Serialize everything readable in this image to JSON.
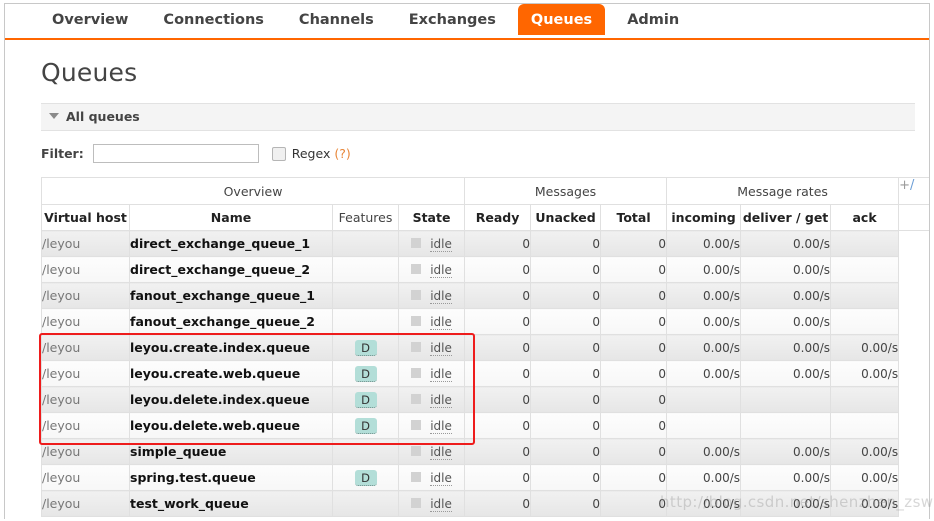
{
  "nav": {
    "tabs": [
      {
        "label": "Overview",
        "active": false
      },
      {
        "label": "Connections",
        "active": false
      },
      {
        "label": "Channels",
        "active": false
      },
      {
        "label": "Exchanges",
        "active": false
      },
      {
        "label": "Queues",
        "active": true
      },
      {
        "label": "Admin",
        "active": false
      }
    ],
    "active_color": "#ff6600"
  },
  "page": {
    "title": "Queues",
    "section_title": "All queues"
  },
  "filter": {
    "label": "Filter:",
    "value": "",
    "placeholder": "",
    "regex_label": "Regex",
    "regex_checked": false,
    "help": "(?)"
  },
  "table": {
    "group_headers": [
      {
        "label": "Overview",
        "span": 4
      },
      {
        "label": "Messages",
        "span": 3
      },
      {
        "label": "Message rates",
        "span": 3
      }
    ],
    "columns": [
      {
        "label": "Virtual host",
        "sortable": true
      },
      {
        "label": "Name",
        "sortable": true
      },
      {
        "label": "Features",
        "sortable": false
      },
      {
        "label": "State",
        "sortable": true
      },
      {
        "label": "Ready",
        "sortable": true
      },
      {
        "label": "Unacked",
        "sortable": true
      },
      {
        "label": "Total",
        "sortable": true
      },
      {
        "label": "incoming",
        "sortable": true
      },
      {
        "label": "deliver / get",
        "sortable": true
      },
      {
        "label": "ack",
        "sortable": true
      }
    ],
    "plus_minus": "+/",
    "rows": [
      {
        "vhost": "/leyou",
        "name": "direct_exchange_queue_1",
        "features": "",
        "state": "idle",
        "ready": "0",
        "unacked": "0",
        "total": "0",
        "incoming": "0.00/s",
        "deliver_get": "0.00/s",
        "ack": ""
      },
      {
        "vhost": "/leyou",
        "name": "direct_exchange_queue_2",
        "features": "",
        "state": "idle",
        "ready": "0",
        "unacked": "0",
        "total": "0",
        "incoming": "0.00/s",
        "deliver_get": "0.00/s",
        "ack": ""
      },
      {
        "vhost": "/leyou",
        "name": "fanout_exchange_queue_1",
        "features": "",
        "state": "idle",
        "ready": "0",
        "unacked": "0",
        "total": "0",
        "incoming": "0.00/s",
        "deliver_get": "0.00/s",
        "ack": ""
      },
      {
        "vhost": "/leyou",
        "name": "fanout_exchange_queue_2",
        "features": "",
        "state": "idle",
        "ready": "0",
        "unacked": "0",
        "total": "0",
        "incoming": "0.00/s",
        "deliver_get": "0.00/s",
        "ack": ""
      },
      {
        "vhost": "/leyou",
        "name": "leyou.create.index.queue",
        "features": "D",
        "state": "idle",
        "ready": "0",
        "unacked": "0",
        "total": "0",
        "incoming": "0.00/s",
        "deliver_get": "0.00/s",
        "ack": "0.00/s"
      },
      {
        "vhost": "/leyou",
        "name": "leyou.create.web.queue",
        "features": "D",
        "state": "idle",
        "ready": "0",
        "unacked": "0",
        "total": "0",
        "incoming": "0.00/s",
        "deliver_get": "0.00/s",
        "ack": "0.00/s"
      },
      {
        "vhost": "/leyou",
        "name": "leyou.delete.index.queue",
        "features": "D",
        "state": "idle",
        "ready": "0",
        "unacked": "0",
        "total": "0",
        "incoming": "",
        "deliver_get": "",
        "ack": ""
      },
      {
        "vhost": "/leyou",
        "name": "leyou.delete.web.queue",
        "features": "D",
        "state": "idle",
        "ready": "0",
        "unacked": "0",
        "total": "0",
        "incoming": "",
        "deliver_get": "",
        "ack": ""
      },
      {
        "vhost": "/leyou",
        "name": "simple_queue",
        "features": "",
        "state": "idle",
        "ready": "0",
        "unacked": "0",
        "total": "0",
        "incoming": "0.00/s",
        "deliver_get": "0.00/s",
        "ack": "0.00/s"
      },
      {
        "vhost": "/leyou",
        "name": "spring.test.queue",
        "features": "D",
        "state": "idle",
        "ready": "0",
        "unacked": "0",
        "total": "0",
        "incoming": "0.00/s",
        "deliver_get": "0.00/s",
        "ack": "0.00/s"
      },
      {
        "vhost": "/leyou",
        "name": "test_work_queue",
        "features": "",
        "state": "idle",
        "ready": "0",
        "unacked": "0",
        "total": "0",
        "incoming": "0.00/s",
        "deliver_get": "0.00/s",
        "ack": "0.00/s"
      }
    ]
  },
  "annotation": {
    "highlight_color": "#ee1c1c",
    "highlight_first_row": 4,
    "highlight_row_count": 4
  },
  "watermark": {
    "text": "http://blog.csdn.net/shenzhen_zsw"
  }
}
